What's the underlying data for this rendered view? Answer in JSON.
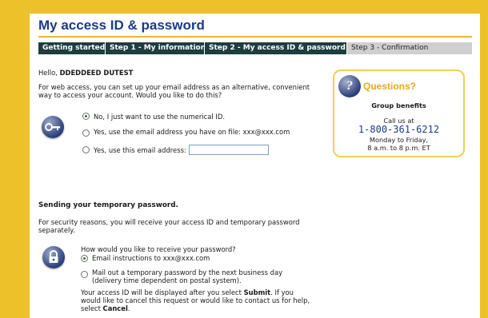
{
  "page": {
    "title": "My access ID & password"
  },
  "steps": [
    {
      "label": "Getting started"
    },
    {
      "label": "Step 1 - My information"
    },
    {
      "label": "Step 2 - My access ID & password"
    },
    {
      "label": "Step 3 - Confirmation"
    }
  ],
  "greeting": {
    "prefix": "Hello, ",
    "name": "DDEDDEED DUTEST"
  },
  "access": {
    "intro_line1": "For web access, you can set up your email address as an alternative, convenient",
    "intro_line2": "way to access your account. Would you like to do this?",
    "options": [
      {
        "label": "No, I just want to use the numerical ID.",
        "selected": true
      },
      {
        "label": "Yes, use the email address you have on file: xxx@xxx.com",
        "selected": false
      },
      {
        "label": "Yes, use this email address:",
        "selected": false
      }
    ],
    "email_value": ""
  },
  "questions": {
    "title": "Questions?",
    "subtitle": "Group benefits",
    "call_label": "Call us at",
    "phone": "1-800-361-6212",
    "hours_line1": "Monday to Friday,",
    "hours_line2": "8 a.m. to 8 p.m. ET"
  },
  "password": {
    "section_title": "Sending your temporary password.",
    "intro_line1": "For security reasons, you will receive your access ID and temporary password",
    "intro_line2": "separately.",
    "question": "How would you like to receive your password?",
    "options": [
      {
        "label": "Email instructions to xxx@xxx.com",
        "selected": true
      },
      {
        "label_line1": "Mail out a temporary password by the next business day",
        "label_line2": "(delivery time dependent on postal system).",
        "selected": false
      }
    ],
    "note_line1_a": "Your access ID will be displayed after you select ",
    "note_line1_submit": "Submit",
    "note_line1_b": ". If you",
    "note_line2": "would like to cancel this request or would like to contact us for help,",
    "note_line3_a": "select ",
    "note_line3_cancel": "Cancel",
    "note_line3_b": "."
  },
  "colors": {
    "background": "#ecc12a",
    "title": "#1b3a8a",
    "step_active": "#1e3d40",
    "step_inactive": "#cfcfcf",
    "accent": "#e3ab1d"
  }
}
